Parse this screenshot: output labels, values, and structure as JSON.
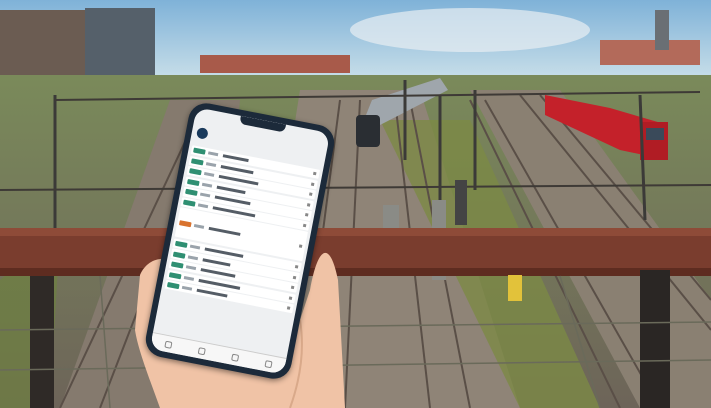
{
  "scene": {
    "description_colors": {
      "sky": "#9cc4df",
      "gravel": "#8a7e70",
      "grass": "#7f8c4a",
      "railing": "#7a3d2e",
      "train_red": "#c4212a",
      "phone_frame": "#1c2a3a",
      "tag_green": "#2f8f72",
      "tag_orange": "#d9732e"
    }
  },
  "phone": {
    "status_bar": {
      "time": "",
      "signal": ""
    },
    "app": {
      "title": "",
      "logo_icon": "train-logo-icon"
    },
    "rows": [
      {
        "tag": "green"
      },
      {
        "tag": "green"
      },
      {
        "tag": "green"
      },
      {
        "tag": "green",
        "tall": false
      },
      {
        "tag": "green"
      },
      {
        "tag": "green"
      },
      {
        "tag": "orange",
        "tall": true
      },
      {
        "tag": "green"
      },
      {
        "tag": "green"
      },
      {
        "tag": "green"
      },
      {
        "tag": "green"
      },
      {
        "tag": "green"
      }
    ],
    "tabs": [
      "home-tab-icon",
      "search-tab-icon",
      "ticket-tab-icon",
      "profile-tab-icon"
    ]
  }
}
